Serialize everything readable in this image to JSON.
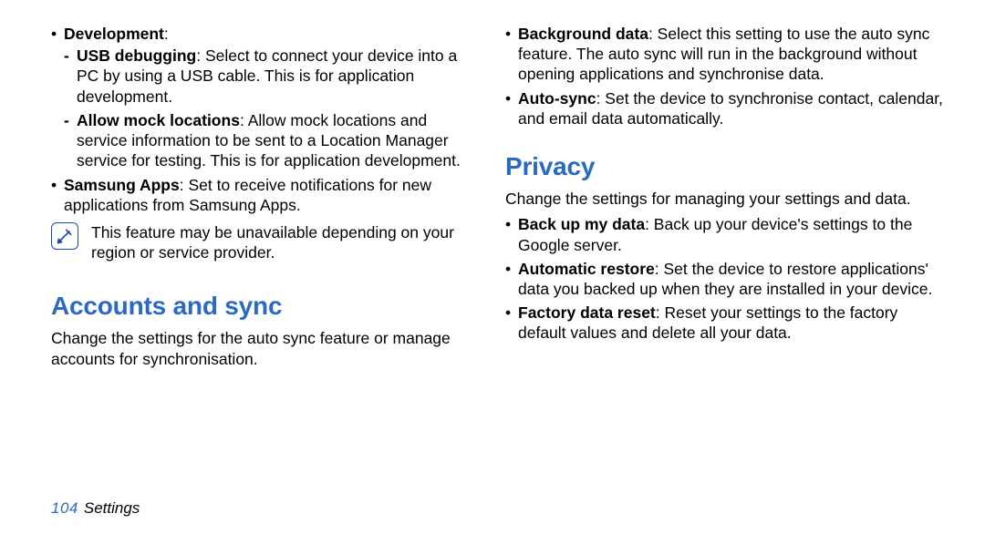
{
  "left": {
    "dev_heading": "Development",
    "usb_debug_term": "USB debugging",
    "usb_debug_desc": ": Select to connect your device into a PC by using a USB cable. This is for application development.",
    "mock_term": "Allow mock locations",
    "mock_desc": ": Allow mock locations and service information to be sent to a Location Manager service for testing. This is for application development.",
    "samsung_term": "Samsung Apps",
    "samsung_desc": ": Set to receive notifications for new applications from Samsung Apps.",
    "note": "This feature may be unavailable depending on your region or service provider.",
    "accounts_heading": "Accounts and sync",
    "accounts_intro": "Change the settings for the auto sync feature or manage accounts for synchronisation."
  },
  "right": {
    "bg_term": "Background data",
    "bg_desc": ": Select this setting to use the auto sync feature. The auto sync will run in the background without opening applications and synchronise data.",
    "autosync_term": "Auto-sync",
    "autosync_desc": ": Set the device to synchronise contact, calendar, and email data automatically.",
    "privacy_heading": "Privacy",
    "privacy_intro": "Change the settings for managing your settings and data.",
    "backup_term": "Back up my data",
    "backup_desc": ": Back up your device's settings to the Google server.",
    "restore_term": "Automatic restore",
    "restore_desc": ": Set the device to restore applications' data you backed up when they are installed in your device.",
    "reset_term": "Factory data reset",
    "reset_desc": ": Reset your settings to the factory default values and delete all your data."
  },
  "footer": {
    "page": "104",
    "label": "Settings"
  }
}
